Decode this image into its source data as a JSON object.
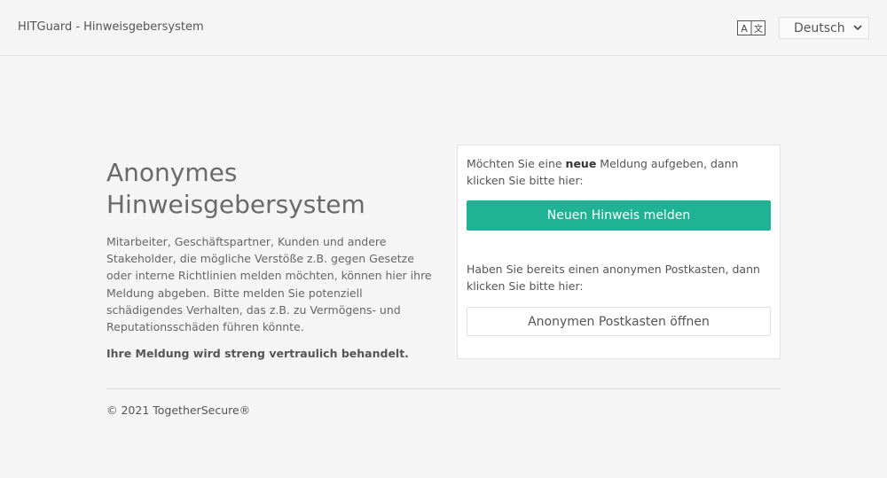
{
  "header": {
    "app_title": "HITGuard - Hinweisgebersystem",
    "language_icon": "translate-icon",
    "language_selected": "Deutsch"
  },
  "intro": {
    "title": "Anonymes Hinweisgebersystem",
    "description": "Mitarbeiter, Geschäftspartner, Kunden und andere Stakeholder, die mögliche Verstöße z.B. gegen Gesetze oder interne Richtlinien melden möchten, können hier ihre Meldung abgeben. Bitte melden Sie potenziell schädigendes Verhalten, das z.B. zu Vermögens- und Reputationsschäden führen könnte.",
    "confidential_note": "Ihre Meldung wird streng vertraulich behandelt."
  },
  "card": {
    "new_prompt_before": "Möchten Sie eine ",
    "new_prompt_bold": "neue",
    "new_prompt_after": " Meldung aufgeben, dann klicken Sie bitte hier:",
    "new_button_label": "Neuen Hinweis melden",
    "mailbox_prompt": "Haben Sie bereits einen anonymen Postkasten, dann klicken Sie bitte hier:",
    "mailbox_button_label": "Anonymen Postkasten öffnen"
  },
  "footer": {
    "copyright": "© 2021 TogetherSecure®"
  },
  "colors": {
    "accent": "#1fb294",
    "background": "#f5f5f5"
  }
}
